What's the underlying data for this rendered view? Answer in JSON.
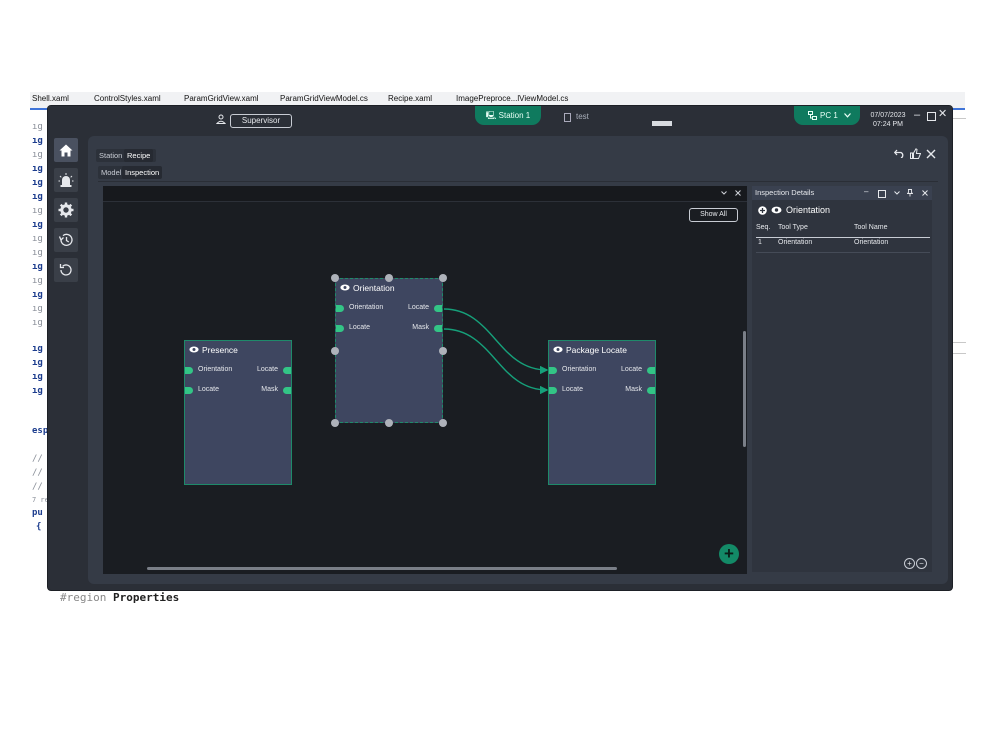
{
  "ide": {
    "tabs": [
      "Shell.xaml",
      "ControlStyles.xaml",
      "ParamGridView.xaml",
      "ParamGridViewModel.cs",
      "Recipe.xaml",
      "ImagePreproce...lViewModel.cs"
    ],
    "gutter": [
      "ıg",
      "ıg",
      "ıg",
      "ıg",
      "ıg",
      "ıg",
      "ıg",
      "ıg",
      "ıg",
      "ıg",
      "ıg",
      "ıg",
      "ıg",
      "ıg",
      "ıg",
      "ıg",
      "ıg",
      "ıg",
      "ıg"
    ],
    "gutter_extra": [
      "esp",
      "//",
      "//",
      "//",
      "7 re",
      "pu",
      "{"
    ],
    "region_keyword": "#region",
    "region_name": "Properties"
  },
  "titlebar": {
    "role": "Supervisor",
    "station": "Station 1",
    "test_label": "test",
    "pc": "PC 1",
    "date": "07/07/2023",
    "time": "07:24 PM"
  },
  "tabs_top": [
    "Station",
    "Recipe"
  ],
  "tabs_sub": [
    "Model",
    "Inspection"
  ],
  "canvas": {
    "show_all": "Show All",
    "nodes": [
      {
        "title": "Presence",
        "in": [
          "Orientation",
          "Locate"
        ],
        "out": [
          "Locate",
          "Mask"
        ]
      },
      {
        "title": "Orientation",
        "in": [
          "Orientation",
          "Locate"
        ],
        "out": [
          "Locate",
          "Mask"
        ]
      },
      {
        "title": "Package Locate",
        "in": [
          "Orientation",
          "Locate"
        ],
        "out": [
          "Locate",
          "Mask"
        ]
      }
    ]
  },
  "details": {
    "title": "Inspection Details",
    "selected_tool": "Orientation",
    "columns": [
      "Seq.",
      "Tool Type",
      "Tool Name"
    ],
    "rows": [
      {
        "seq": "1",
        "type": "Orientation",
        "name": "Orientation"
      }
    ]
  },
  "colors": {
    "accent": "#0f7a5e",
    "port": "#33c586",
    "node": "#3e4660",
    "canvas": "#1a1d22"
  }
}
